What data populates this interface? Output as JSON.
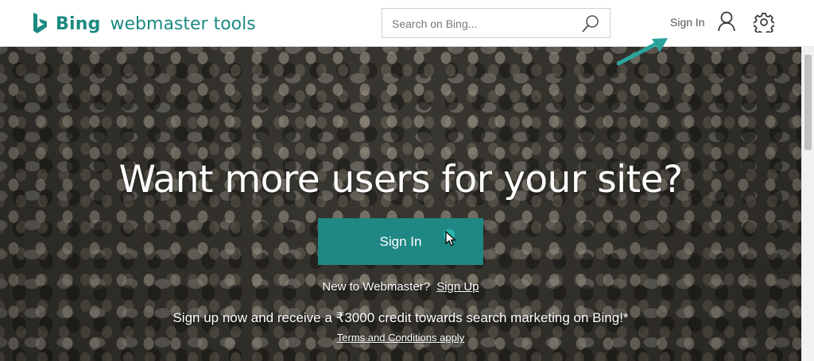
{
  "header": {
    "brand": "Bing",
    "product": "webmaster tools",
    "search_placeholder": "Search on Bing...",
    "signin_label": "Sign In",
    "icons": [
      "bing-logo-icon",
      "search-icon",
      "user-icon",
      "gear-icon"
    ]
  },
  "hero": {
    "title": "Want more users for your site?",
    "signin_button": "Sign In",
    "new_to": "New to Webmaster?",
    "signup_link": "Sign Up",
    "promo": "Sign up now and receive a ₹3000 credit towards search marketing on Bing!*",
    "terms": "Terms and Conditions apply"
  },
  "colors": {
    "brand": "#1b8a82",
    "button": "#1f8784",
    "annotation_arrow": "#2aa39a"
  }
}
